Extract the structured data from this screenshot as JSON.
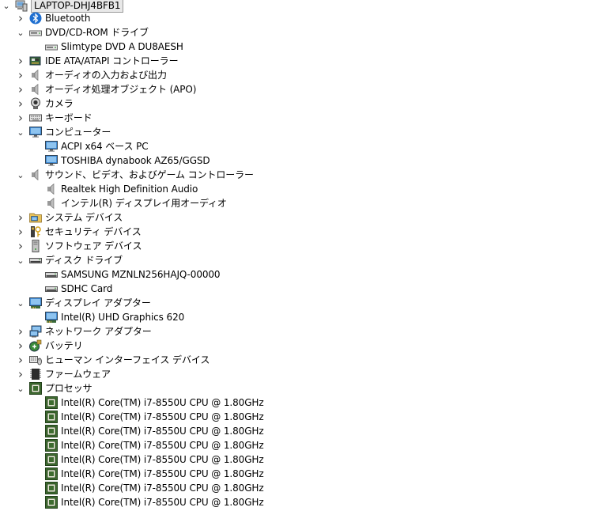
{
  "root": {
    "label": "LAPTOP-DHJ4BFB1",
    "expanded": true
  },
  "items": [
    {
      "label": "Bluetooth",
      "level": 1,
      "expanded": false,
      "icon": "bluetooth-icon"
    },
    {
      "label": "DVD/CD-ROM ドライブ",
      "level": 1,
      "expanded": true,
      "icon": "dvd-drive-icon"
    },
    {
      "label": "Slimtype DVD A  DU8AESH",
      "level": 2,
      "icon": "dvd-drive-icon"
    },
    {
      "label": "IDE ATA/ATAPI コントローラー",
      "level": 1,
      "expanded": false,
      "icon": "ide-controller-icon"
    },
    {
      "label": "オーディオの入力および出力",
      "level": 1,
      "expanded": false,
      "icon": "speaker-icon"
    },
    {
      "label": "オーディオ処理オブジェクト (APO)",
      "level": 1,
      "expanded": false,
      "icon": "speaker-icon"
    },
    {
      "label": "カメラ",
      "level": 1,
      "expanded": false,
      "icon": "camera-icon"
    },
    {
      "label": "キーボード",
      "level": 1,
      "expanded": false,
      "icon": "keyboard-icon"
    },
    {
      "label": "コンピューター",
      "level": 1,
      "expanded": true,
      "icon": "monitor-icon"
    },
    {
      "label": "ACPI x64 ベース PC",
      "level": 2,
      "icon": "monitor-icon"
    },
    {
      "label": "TOSHIBA dynabook AZ65/GGSD",
      "level": 2,
      "icon": "monitor-icon"
    },
    {
      "label": "サウンド、ビデオ、およびゲーム コントローラー",
      "level": 1,
      "expanded": true,
      "icon": "speaker-icon"
    },
    {
      "label": "Realtek High Definition Audio",
      "level": 2,
      "icon": "speaker-icon"
    },
    {
      "label": "インテル(R) ディスプレイ用オーディオ",
      "level": 2,
      "icon": "speaker-icon"
    },
    {
      "label": "システム デバイス",
      "level": 1,
      "expanded": false,
      "icon": "system-folder-icon"
    },
    {
      "label": "セキュリティ デバイス",
      "level": 1,
      "expanded": false,
      "icon": "security-key-icon"
    },
    {
      "label": "ソフトウェア デバイス",
      "level": 1,
      "expanded": false,
      "icon": "tower-icon"
    },
    {
      "label": "ディスク ドライブ",
      "level": 1,
      "expanded": true,
      "icon": "disk-drive-icon"
    },
    {
      "label": "SAMSUNG MZNLN256HAJQ-00000",
      "level": 2,
      "icon": "disk-drive-icon"
    },
    {
      "label": "SDHC Card",
      "level": 2,
      "icon": "disk-drive-icon"
    },
    {
      "label": "ディスプレイ アダプター",
      "level": 1,
      "expanded": true,
      "icon": "display-adapter-icon"
    },
    {
      "label": "Intel(R) UHD Graphics 620",
      "level": 2,
      "icon": "display-adapter-icon"
    },
    {
      "label": "ネットワーク アダプター",
      "level": 1,
      "expanded": false,
      "icon": "network-icon"
    },
    {
      "label": "バッテリ",
      "level": 1,
      "expanded": false,
      "icon": "battery-icon"
    },
    {
      "label": "ヒューマン インターフェイス デバイス",
      "level": 1,
      "expanded": false,
      "icon": "hid-icon"
    },
    {
      "label": "ファームウェア",
      "level": 1,
      "expanded": false,
      "icon": "firmware-icon"
    },
    {
      "label": "プロセッサ",
      "level": 1,
      "expanded": true,
      "icon": "processor-icon"
    },
    {
      "label": "Intel(R) Core(TM) i7-8550U CPU @ 1.80GHz",
      "level": 2,
      "icon": "processor-icon"
    },
    {
      "label": "Intel(R) Core(TM) i7-8550U CPU @ 1.80GHz",
      "level": 2,
      "icon": "processor-icon"
    },
    {
      "label": "Intel(R) Core(TM) i7-8550U CPU @ 1.80GHz",
      "level": 2,
      "icon": "processor-icon"
    },
    {
      "label": "Intel(R) Core(TM) i7-8550U CPU @ 1.80GHz",
      "level": 2,
      "icon": "processor-icon"
    },
    {
      "label": "Intel(R) Core(TM) i7-8550U CPU @ 1.80GHz",
      "level": 2,
      "icon": "processor-icon"
    },
    {
      "label": "Intel(R) Core(TM) i7-8550U CPU @ 1.80GHz",
      "level": 2,
      "icon": "processor-icon"
    },
    {
      "label": "Intel(R) Core(TM) i7-8550U CPU @ 1.80GHz",
      "level": 2,
      "icon": "processor-icon"
    },
    {
      "label": "Intel(R) Core(TM) i7-8550U CPU @ 1.80GHz",
      "level": 2,
      "icon": "processor-icon"
    }
  ]
}
